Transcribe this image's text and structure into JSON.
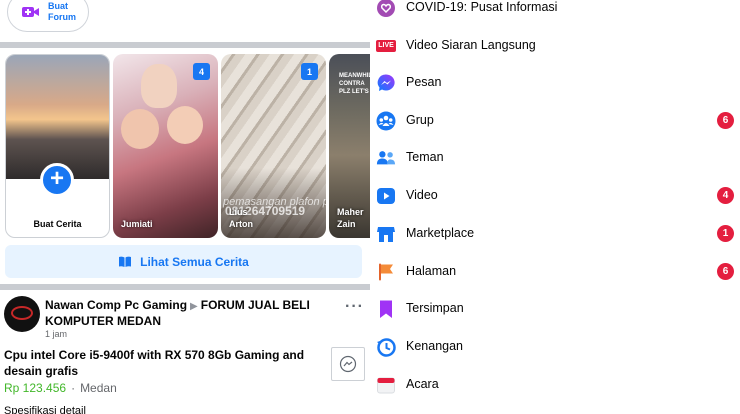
{
  "feed": {
    "forum_button": {
      "label": "Buat Forum"
    },
    "stories": {
      "create_label": "Buat Cerita",
      "items": [
        {
          "name": "Jumiati",
          "count": "4"
        },
        {
          "name": "Lius\nArton",
          "count": "1",
          "overlay_text": "pemasangan plafon pvc",
          "overlay_phone": "081264709519"
        },
        {
          "name": "Maher\nZain",
          "overlay_text": "MEANWHILE\nCONTRA\nPLZ LET'S M"
        }
      ],
      "see_all_label": "Lihat Semua Cerita"
    },
    "post": {
      "author": "Nawan Comp Pc Gaming",
      "group": "FORUM JUAL BELI KOMPUTER MEDAN",
      "time": "1 jam",
      "title": "Cpu intel Core i5-9400f with RX 570 8Gb Gaming and desain grafis",
      "price": "Rp 123.456",
      "separator": "·",
      "location": "Medan",
      "spec_label": "Spesifikasi detail"
    }
  },
  "menu": {
    "items": [
      {
        "label": "COVID-19: Pusat Informasi",
        "icon": "covid-heart-icon"
      },
      {
        "label": "Video Siaran Langsung",
        "icon": "live-icon",
        "icon_text": "LIVE"
      },
      {
        "label": "Pesan",
        "icon": "messenger-icon"
      },
      {
        "label": "Grup",
        "icon": "groups-icon",
        "count": "6"
      },
      {
        "label": "Teman",
        "icon": "friends-icon"
      },
      {
        "label": "Video",
        "icon": "video-icon",
        "count": "4"
      },
      {
        "label": "Marketplace",
        "icon": "marketplace-icon",
        "count": "1"
      },
      {
        "label": "Halaman",
        "icon": "pages-flag-icon",
        "count": "6"
      },
      {
        "label": "Tersimpan",
        "icon": "saved-bookmark-icon"
      },
      {
        "label": "Kenangan",
        "icon": "memories-clock-icon"
      },
      {
        "label": "Acara",
        "icon": "events-calendar-icon"
      }
    ]
  },
  "colors": {
    "accent": "#1877f2",
    "badge_red": "#e41e3f",
    "price_green": "#42b72a",
    "divider": "#c9ccd1"
  }
}
